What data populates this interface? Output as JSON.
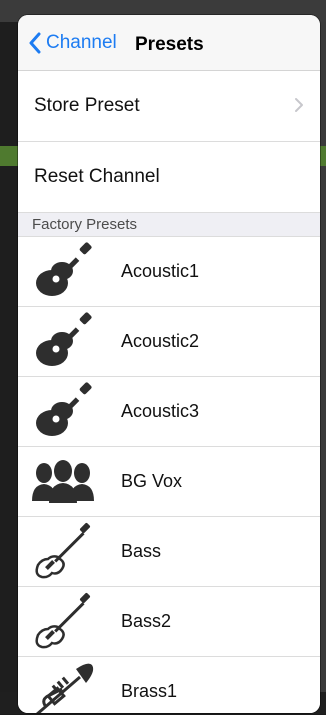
{
  "nav": {
    "back_label": "Channel",
    "title": "Presets"
  },
  "actions": [
    {
      "label": "Store Preset",
      "has_chevron": true
    },
    {
      "label": "Reset Channel",
      "has_chevron": false
    }
  ],
  "section_header": "Factory Presets",
  "presets": [
    {
      "label": "Acoustic1",
      "icon": "acoustic-guitar-icon"
    },
    {
      "label": "Acoustic2",
      "icon": "acoustic-guitar-icon"
    },
    {
      "label": "Acoustic3",
      "icon": "acoustic-guitar-icon"
    },
    {
      "label": "BG Vox",
      "icon": "vocal-group-icon"
    },
    {
      "label": "Bass",
      "icon": "bass-guitar-icon"
    },
    {
      "label": "Bass2",
      "icon": "bass-guitar-icon"
    },
    {
      "label": "Brass1",
      "icon": "trumpet-icon"
    }
  ],
  "colors": {
    "accent": "#1d7cf2",
    "icon": "#2e2e2e",
    "section_bg": "#efeff4"
  }
}
